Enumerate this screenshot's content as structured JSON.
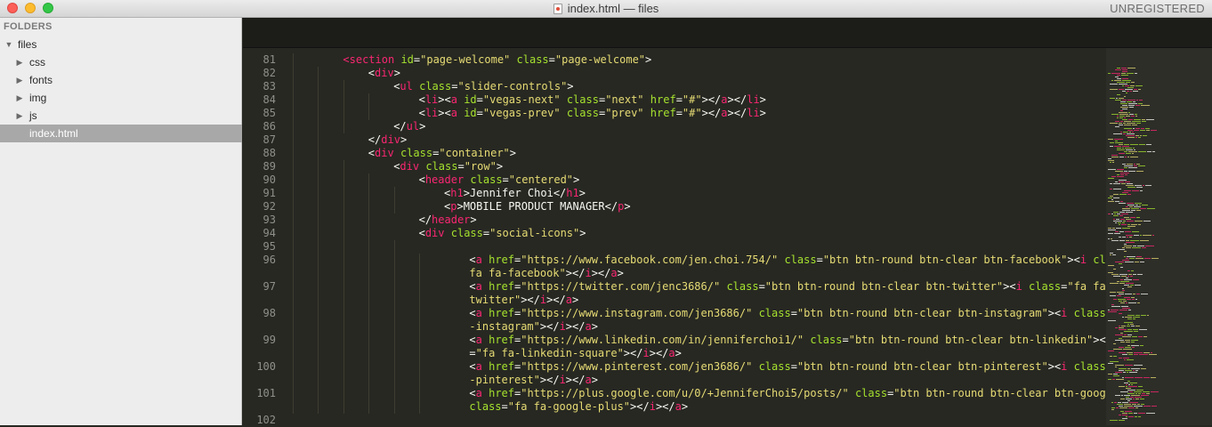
{
  "window": {
    "title": "index.html — files",
    "status": "UNREGISTERED"
  },
  "sidebar": {
    "header": "FOLDERS",
    "root": {
      "label": "files",
      "expanded": true
    },
    "items": [
      {
        "label": "css",
        "type": "folder"
      },
      {
        "label": "fonts",
        "type": "folder"
      },
      {
        "label": "img",
        "type": "folder"
      },
      {
        "label": "js",
        "type": "folder"
      },
      {
        "label": "index.html",
        "type": "file",
        "selected": true
      }
    ]
  },
  "editor": {
    "lines": [
      {
        "num": "81",
        "indent": 1,
        "tokens": [
          [
            "t",
            "<"
          ],
          [
            "t",
            "section"
          ],
          [
            "p",
            " "
          ],
          [
            "a",
            "id"
          ],
          [
            "p",
            "="
          ],
          [
            "s",
            "\"page-welcome\""
          ],
          [
            "p",
            " "
          ],
          [
            "a",
            "class"
          ],
          [
            "p",
            "="
          ],
          [
            "s",
            "\"page-welcome\""
          ],
          [
            "p",
            ">"
          ]
        ]
      },
      {
        "num": "82",
        "indent": 2,
        "tokens": [
          [
            "p",
            "<"
          ],
          [
            "t",
            "div"
          ],
          [
            "p",
            ">"
          ]
        ]
      },
      {
        "num": "83",
        "indent": 3,
        "tokens": [
          [
            "p",
            "<"
          ],
          [
            "t",
            "ul"
          ],
          [
            "p",
            " "
          ],
          [
            "a",
            "class"
          ],
          [
            "p",
            "="
          ],
          [
            "s",
            "\"slider-controls\""
          ],
          [
            "p",
            ">"
          ]
        ]
      },
      {
        "num": "84",
        "indent": 4,
        "tokens": [
          [
            "p",
            "<"
          ],
          [
            "t",
            "li"
          ],
          [
            "p",
            "><"
          ],
          [
            "t",
            "a"
          ],
          [
            "p",
            " "
          ],
          [
            "a",
            "id"
          ],
          [
            "p",
            "="
          ],
          [
            "s",
            "\"vegas-next\""
          ],
          [
            "p",
            " "
          ],
          [
            "a",
            "class"
          ],
          [
            "p",
            "="
          ],
          [
            "s",
            "\"next\""
          ],
          [
            "p",
            " "
          ],
          [
            "a",
            "href"
          ],
          [
            "p",
            "="
          ],
          [
            "s",
            "\"#\""
          ],
          [
            "p",
            "></"
          ],
          [
            "t",
            "a"
          ],
          [
            "p",
            "></"
          ],
          [
            "t",
            "li"
          ],
          [
            "p",
            ">"
          ]
        ]
      },
      {
        "num": "85",
        "indent": 4,
        "tokens": [
          [
            "p",
            "<"
          ],
          [
            "t",
            "li"
          ],
          [
            "p",
            "><"
          ],
          [
            "t",
            "a"
          ],
          [
            "p",
            " "
          ],
          [
            "a",
            "id"
          ],
          [
            "p",
            "="
          ],
          [
            "s",
            "\"vegas-prev\""
          ],
          [
            "p",
            " "
          ],
          [
            "a",
            "class"
          ],
          [
            "p",
            "="
          ],
          [
            "s",
            "\"prev\""
          ],
          [
            "p",
            " "
          ],
          [
            "a",
            "href"
          ],
          [
            "p",
            "="
          ],
          [
            "s",
            "\"#\""
          ],
          [
            "p",
            "></"
          ],
          [
            "t",
            "a"
          ],
          [
            "p",
            "></"
          ],
          [
            "t",
            "li"
          ],
          [
            "p",
            ">"
          ]
        ]
      },
      {
        "num": "86",
        "indent": 3,
        "tokens": [
          [
            "p",
            "</"
          ],
          [
            "t",
            "ul"
          ],
          [
            "p",
            ">"
          ]
        ]
      },
      {
        "num": "87",
        "indent": 2,
        "tokens": [
          [
            "p",
            "</"
          ],
          [
            "t",
            "div"
          ],
          [
            "p",
            ">"
          ]
        ]
      },
      {
        "num": "88",
        "indent": 2,
        "tokens": [
          [
            "p",
            "<"
          ],
          [
            "t",
            "div"
          ],
          [
            "p",
            " "
          ],
          [
            "a",
            "class"
          ],
          [
            "p",
            "="
          ],
          [
            "s",
            "\"container\""
          ],
          [
            "p",
            ">"
          ]
        ]
      },
      {
        "num": "89",
        "indent": 3,
        "tokens": [
          [
            "p",
            "<"
          ],
          [
            "t",
            "div"
          ],
          [
            "p",
            " "
          ],
          [
            "a",
            "class"
          ],
          [
            "p",
            "="
          ],
          [
            "s",
            "\"row\""
          ],
          [
            "p",
            ">"
          ]
        ]
      },
      {
        "num": "90",
        "indent": 4,
        "tokens": [
          [
            "p",
            "<"
          ],
          [
            "t",
            "header"
          ],
          [
            "p",
            " "
          ],
          [
            "a",
            "class"
          ],
          [
            "p",
            "="
          ],
          [
            "s",
            "\"centered\""
          ],
          [
            "p",
            ">"
          ]
        ]
      },
      {
        "num": "91",
        "indent": 5,
        "tokens": [
          [
            "p",
            "<"
          ],
          [
            "t",
            "h1"
          ],
          [
            "p",
            ">Jennifer Choi</"
          ],
          [
            "t",
            "h1"
          ],
          [
            "p",
            ">"
          ]
        ]
      },
      {
        "num": "92",
        "indent": 5,
        "tokens": [
          [
            "p",
            "<"
          ],
          [
            "t",
            "p"
          ],
          [
            "p",
            ">MOBILE PRODUCT MANAGER</"
          ],
          [
            "t",
            "p"
          ],
          [
            "p",
            ">"
          ]
        ]
      },
      {
        "num": "93",
        "indent": 4,
        "tokens": [
          [
            "p",
            "</"
          ],
          [
            "t",
            "header"
          ],
          [
            "p",
            ">"
          ]
        ]
      },
      {
        "num": "94",
        "indent": 4,
        "tokens": [
          [
            "p",
            "<"
          ],
          [
            "t",
            "div"
          ],
          [
            "p",
            " "
          ],
          [
            "a",
            "class"
          ],
          [
            "p",
            "="
          ],
          [
            "s",
            "\"social-icons\""
          ],
          [
            "p",
            ">"
          ]
        ]
      },
      {
        "num": "95",
        "indent": 5,
        "tokens": []
      },
      {
        "num": "96",
        "indent": 6,
        "tokens": [
          [
            "p",
            "<"
          ],
          [
            "t",
            "a"
          ],
          [
            "p",
            " "
          ],
          [
            "a",
            "href"
          ],
          [
            "p",
            "="
          ],
          [
            "s",
            "\"https://www.facebook.com/jen.choi.754/\""
          ],
          [
            "p",
            " "
          ],
          [
            "a",
            "class"
          ],
          [
            "p",
            "="
          ],
          [
            "s",
            "\"btn btn-round btn-clear btn-facebook\""
          ],
          [
            "p",
            "><"
          ],
          [
            "t",
            "i"
          ],
          [
            "p",
            " "
          ],
          [
            "a",
            "class"
          ],
          [
            "p",
            "="
          ],
          [
            "s",
            "\""
          ]
        ]
      },
      {
        "num": "",
        "indent": 6,
        "tokens": [
          [
            "s",
            "fa fa-facebook\""
          ],
          [
            "p",
            "></"
          ],
          [
            "t",
            "i"
          ],
          [
            "p",
            "></"
          ],
          [
            "t",
            "a"
          ],
          [
            "p",
            ">"
          ]
        ]
      },
      {
        "num": "97",
        "indent": 6,
        "tokens": [
          [
            "p",
            "<"
          ],
          [
            "t",
            "a"
          ],
          [
            "p",
            " "
          ],
          [
            "a",
            "href"
          ],
          [
            "p",
            "="
          ],
          [
            "s",
            "\"https://twitter.com/jenc3686/\""
          ],
          [
            "p",
            " "
          ],
          [
            "a",
            "class"
          ],
          [
            "p",
            "="
          ],
          [
            "s",
            "\"btn btn-round btn-clear btn-twitter\""
          ],
          [
            "p",
            "><"
          ],
          [
            "t",
            "i"
          ],
          [
            "p",
            " "
          ],
          [
            "a",
            "class"
          ],
          [
            "p",
            "="
          ],
          [
            "s",
            "\"fa fa-"
          ]
        ]
      },
      {
        "num": "",
        "indent": 6,
        "tokens": [
          [
            "s",
            "twitter\""
          ],
          [
            "p",
            "></"
          ],
          [
            "t",
            "i"
          ],
          [
            "p",
            "></"
          ],
          [
            "t",
            "a"
          ],
          [
            "p",
            ">"
          ]
        ]
      },
      {
        "num": "98",
        "indent": 6,
        "tokens": [
          [
            "p",
            "<"
          ],
          [
            "t",
            "a"
          ],
          [
            "p",
            " "
          ],
          [
            "a",
            "href"
          ],
          [
            "p",
            "="
          ],
          [
            "s",
            "\"https://www.instagram.com/jen3686/\""
          ],
          [
            "p",
            " "
          ],
          [
            "a",
            "class"
          ],
          [
            "p",
            "="
          ],
          [
            "s",
            "\"btn btn-round btn-clear btn-instagram\""
          ],
          [
            "p",
            "><"
          ],
          [
            "t",
            "i"
          ],
          [
            "p",
            " "
          ],
          [
            "a",
            "class"
          ],
          [
            "p",
            "="
          ],
          [
            "s",
            "\"fa fa"
          ]
        ]
      },
      {
        "num": "",
        "indent": 6,
        "tokens": [
          [
            "s",
            "-instagram\""
          ],
          [
            "p",
            "></"
          ],
          [
            "t",
            "i"
          ],
          [
            "p",
            "></"
          ],
          [
            "t",
            "a"
          ],
          [
            "p",
            ">"
          ]
        ]
      },
      {
        "num": "99",
        "indent": 6,
        "tokens": [
          [
            "p",
            "<"
          ],
          [
            "t",
            "a"
          ],
          [
            "p",
            " "
          ],
          [
            "a",
            "href"
          ],
          [
            "p",
            "="
          ],
          [
            "s",
            "\"https://www.linkedin.com/in/jenniferchoi1/\""
          ],
          [
            "p",
            " "
          ],
          [
            "a",
            "class"
          ],
          [
            "p",
            "="
          ],
          [
            "s",
            "\"btn btn-round btn-clear btn-linkedin\""
          ],
          [
            "p",
            "><"
          ],
          [
            "t",
            "i"
          ],
          [
            "p",
            " "
          ],
          [
            "a",
            "class"
          ]
        ]
      },
      {
        "num": "",
        "indent": 6,
        "tokens": [
          [
            "p",
            "="
          ],
          [
            "s",
            "\"fa fa-linkedin-square\""
          ],
          [
            "p",
            "></"
          ],
          [
            "t",
            "i"
          ],
          [
            "p",
            "></"
          ],
          [
            "t",
            "a"
          ],
          [
            "p",
            ">"
          ]
        ]
      },
      {
        "num": "100",
        "indent": 6,
        "tokens": [
          [
            "p",
            "<"
          ],
          [
            "t",
            "a"
          ],
          [
            "p",
            " "
          ],
          [
            "a",
            "href"
          ],
          [
            "p",
            "="
          ],
          [
            "s",
            "\"https://www.pinterest.com/jen3686/\""
          ],
          [
            "p",
            " "
          ],
          [
            "a",
            "class"
          ],
          [
            "p",
            "="
          ],
          [
            "s",
            "\"btn btn-round btn-clear btn-pinterest\""
          ],
          [
            "p",
            "><"
          ],
          [
            "t",
            "i"
          ],
          [
            "p",
            " "
          ],
          [
            "a",
            "class"
          ],
          [
            "p",
            "="
          ],
          [
            "s",
            "\"fa fa"
          ]
        ]
      },
      {
        "num": "",
        "indent": 6,
        "tokens": [
          [
            "s",
            "-pinterest\""
          ],
          [
            "p",
            "></"
          ],
          [
            "t",
            "i"
          ],
          [
            "p",
            "></"
          ],
          [
            "t",
            "a"
          ],
          [
            "p",
            ">"
          ]
        ]
      },
      {
        "num": "101",
        "indent": 6,
        "tokens": [
          [
            "p",
            "<"
          ],
          [
            "t",
            "a"
          ],
          [
            "p",
            " "
          ],
          [
            "a",
            "href"
          ],
          [
            "p",
            "="
          ],
          [
            "s",
            "\"https://plus.google.com/u/0/+JenniferChoi5/posts/\""
          ],
          [
            "p",
            " "
          ],
          [
            "a",
            "class"
          ],
          [
            "p",
            "="
          ],
          [
            "s",
            "\"btn btn-round btn-clear btn-google\""
          ],
          [
            "p",
            "><"
          ],
          [
            "t",
            "i"
          ]
        ]
      },
      {
        "num": "",
        "indent": 6,
        "tokens": [
          [
            "a",
            "class"
          ],
          [
            "p",
            "="
          ],
          [
            "s",
            "\"fa fa-google-plus\""
          ],
          [
            "p",
            "></"
          ],
          [
            "t",
            "i"
          ],
          [
            "p",
            "></"
          ],
          [
            "t",
            "a"
          ],
          [
            "p",
            ">"
          ]
        ]
      },
      {
        "num": "102",
        "indent": 0,
        "tokens": []
      }
    ]
  },
  "colors": {
    "tag": "#f92672",
    "attr": "#a6e22e",
    "string": "#e6db74",
    "plain": "#f8f8f2",
    "line_number": "#8f908a",
    "background": "#272822"
  }
}
